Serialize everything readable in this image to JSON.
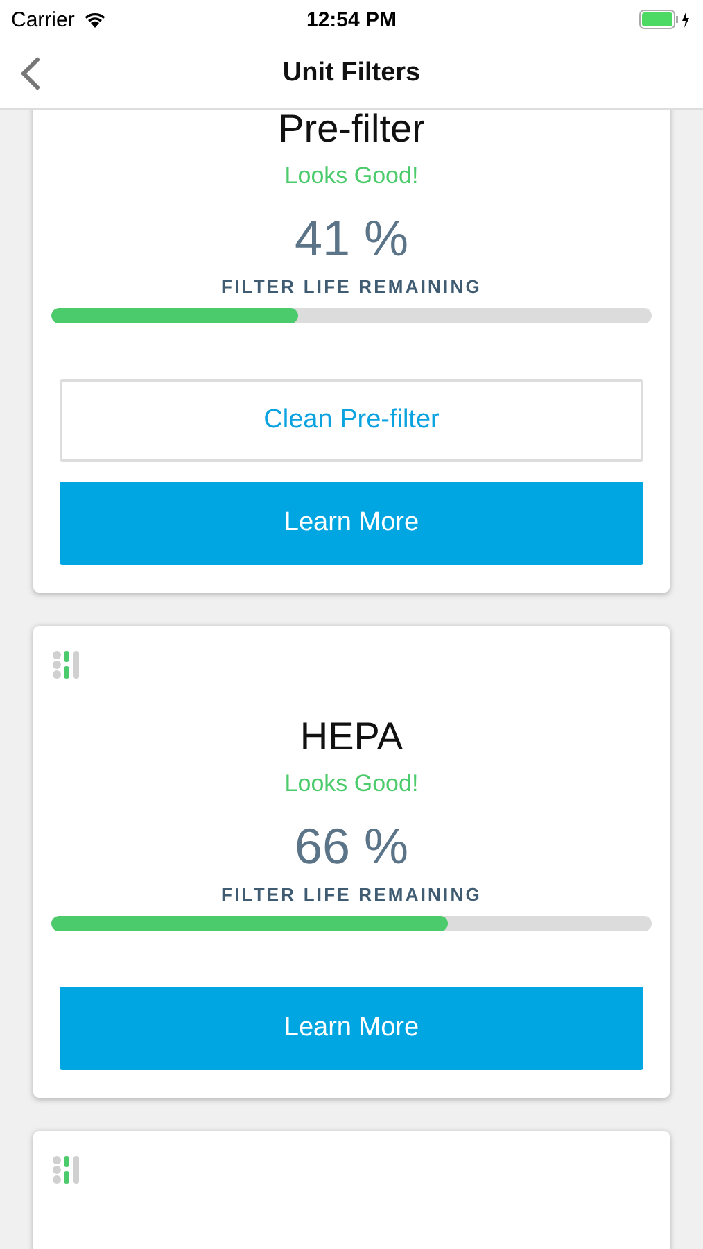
{
  "status_bar": {
    "carrier": "Carrier",
    "time": "12:54 PM"
  },
  "nav": {
    "title": "Unit Filters"
  },
  "filters": [
    {
      "name": "Pre-filter",
      "status": "Looks Good!",
      "percent": "41 %",
      "caption": "FILTER LIFE REMAINING",
      "level": 0.41,
      "buttons": [
        {
          "label": "Clean Pre-filter",
          "kind": "outline"
        },
        {
          "label": "Learn More",
          "kind": "filled"
        }
      ]
    },
    {
      "name": "HEPA",
      "status": "Looks Good!",
      "percent": "66 %",
      "caption": "FILTER LIFE REMAINING",
      "level": 0.66,
      "buttons": [
        {
          "label": "Learn More",
          "kind": "filled"
        }
      ]
    }
  ]
}
